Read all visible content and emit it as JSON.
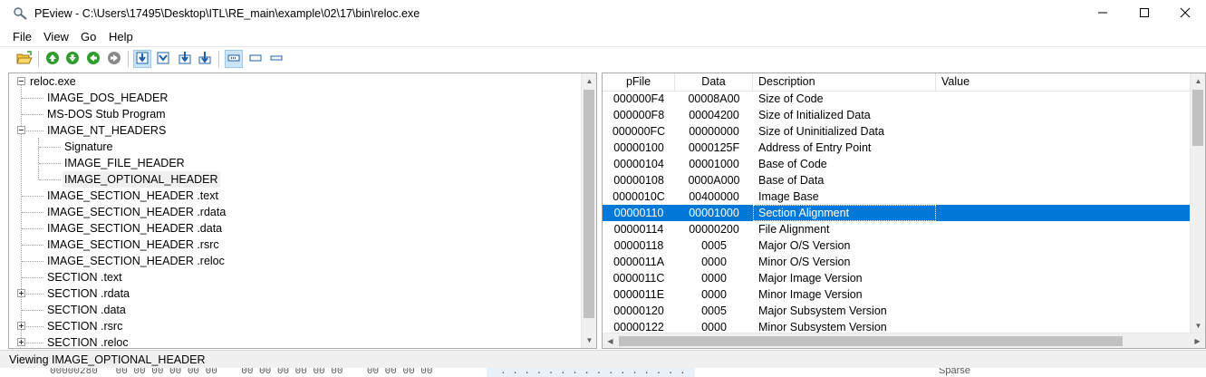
{
  "window": {
    "title": "PEview - C:\\Users\\17495\\Desktop\\ITL\\RE_main\\example\\02\\17\\bin\\reloc.exe",
    "app_icon": "magnifier-icon",
    "controls": [
      "minimize-icon",
      "maximize-icon",
      "close-icon"
    ]
  },
  "menu": [
    "File",
    "View",
    "Go",
    "Help"
  ],
  "toolbar": {
    "buttons": [
      {
        "icon": "open-folder-icon"
      },
      {
        "icon": "go-up-icon",
        "color": "#2e9d2e"
      },
      {
        "icon": "go-down-icon",
        "color": "#2e9d2e"
      },
      {
        "icon": "go-back-icon",
        "color": "#2e9d2e"
      },
      {
        "icon": "go-forward-icon",
        "color": "#8a8a8a"
      },
      {
        "icon": "view-byte-icon",
        "active": true
      },
      {
        "icon": "view-word-icon"
      },
      {
        "icon": "view-dword-icon"
      },
      {
        "icon": "view-qword-icon"
      },
      {
        "icon": "address-rva-icon",
        "active": true
      },
      {
        "icon": "address-va-icon"
      },
      {
        "icon": "address-file-offset-icon"
      }
    ]
  },
  "tree": {
    "root": "reloc.exe",
    "items": [
      {
        "label": "IMAGE_DOS_HEADER",
        "depth": 1,
        "expander": "none"
      },
      {
        "label": "MS-DOS Stub Program",
        "depth": 1,
        "expander": "none"
      },
      {
        "label": "IMAGE_NT_HEADERS",
        "depth": 1,
        "expander": "minus"
      },
      {
        "label": "Signature",
        "depth": 2,
        "expander": "none"
      },
      {
        "label": "IMAGE_FILE_HEADER",
        "depth": 2,
        "expander": "none"
      },
      {
        "label": "IMAGE_OPTIONAL_HEADER",
        "depth": 2,
        "expander": "none",
        "selected": true
      },
      {
        "label": "IMAGE_SECTION_HEADER .text",
        "depth": 1,
        "expander": "none"
      },
      {
        "label": "IMAGE_SECTION_HEADER .rdata",
        "depth": 1,
        "expander": "none"
      },
      {
        "label": "IMAGE_SECTION_HEADER .data",
        "depth": 1,
        "expander": "none"
      },
      {
        "label": "IMAGE_SECTION_HEADER .rsrc",
        "depth": 1,
        "expander": "none"
      },
      {
        "label": "IMAGE_SECTION_HEADER .reloc",
        "depth": 1,
        "expander": "none"
      },
      {
        "label": "SECTION .text",
        "depth": 1,
        "expander": "none"
      },
      {
        "label": "SECTION .rdata",
        "depth": 1,
        "expander": "plus"
      },
      {
        "label": "SECTION .data",
        "depth": 1,
        "expander": "none"
      },
      {
        "label": "SECTION .rsrc",
        "depth": 1,
        "expander": "plus"
      },
      {
        "label": "SECTION .reloc",
        "depth": 1,
        "expander": "plus"
      }
    ]
  },
  "table": {
    "columns": [
      "pFile",
      "Data",
      "Description",
      "Value"
    ],
    "rows": [
      {
        "pfile": "000000F4",
        "data": "00008A00",
        "desc": "Size of Code",
        "value": ""
      },
      {
        "pfile": "000000F8",
        "data": "00004200",
        "desc": "Size of Initialized Data",
        "value": ""
      },
      {
        "pfile": "000000FC",
        "data": "00000000",
        "desc": "Size of Uninitialized Data",
        "value": ""
      },
      {
        "pfile": "00000100",
        "data": "0000125F",
        "desc": "Address of Entry Point",
        "value": ""
      },
      {
        "pfile": "00000104",
        "data": "00001000",
        "desc": "Base of Code",
        "value": ""
      },
      {
        "pfile": "00000108",
        "data": "0000A000",
        "desc": "Base of Data",
        "value": ""
      },
      {
        "pfile": "0000010C",
        "data": "00400000",
        "desc": "Image Base",
        "value": ""
      },
      {
        "pfile": "00000110",
        "data": "00001000",
        "desc": "Section Alignment",
        "value": "",
        "selected": true
      },
      {
        "pfile": "00000114",
        "data": "00000200",
        "desc": "File Alignment",
        "value": ""
      },
      {
        "pfile": "00000118",
        "data": "0005",
        "desc": "Major O/S Version",
        "value": ""
      },
      {
        "pfile": "0000011A",
        "data": "0000",
        "desc": "Minor O/S Version",
        "value": ""
      },
      {
        "pfile": "0000011C",
        "data": "0000",
        "desc": "Major Image Version",
        "value": ""
      },
      {
        "pfile": "0000011E",
        "data": "0000",
        "desc": "Minor Image Version",
        "value": ""
      },
      {
        "pfile": "00000120",
        "data": "0005",
        "desc": "Major Subsystem Version",
        "value": ""
      },
      {
        "pfile": "00000122",
        "data": "0000",
        "desc": "Minor Subsystem Version",
        "value": ""
      }
    ]
  },
  "status": {
    "text": "Viewing IMAGE_OPTIONAL_HEADER"
  },
  "background_window": {
    "hex_fragment": "00000280   00 00 00 00 00 00    00 00 00 00 00 00    00 00 00 00",
    "dots_fragment": ". . . . . . . . . . . . . . . .",
    "right_fragment": "Sparse"
  },
  "colors": {
    "selection": "#0078d7",
    "tree_selection": "#f0f0f0",
    "toolbar_active": "#cce4f7"
  }
}
